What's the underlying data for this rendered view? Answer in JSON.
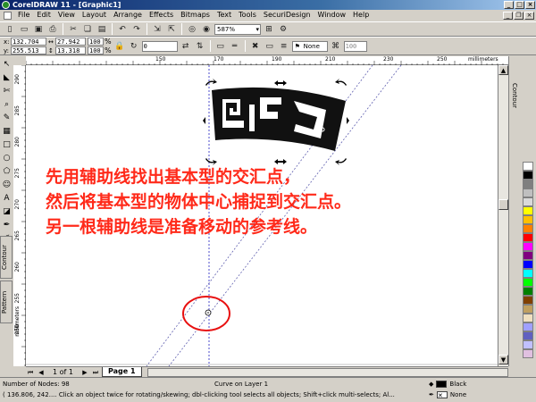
{
  "window": {
    "title": "CorelDRAW 11 - [Graphic1]"
  },
  "menu": [
    "File",
    "Edit",
    "View",
    "Layout",
    "Arrange",
    "Effects",
    "Bitmaps",
    "Text",
    "Tools",
    "SecuriDesign",
    "Window",
    "Help"
  ],
  "toolbar": {
    "zoom": "587%"
  },
  "property_bar": {
    "x": "132.704",
    "y": "255.513",
    "width": "27.942",
    "height": "13.318",
    "scale_w": "100",
    "scale_h": "100",
    "percent_sign": "%",
    "rotation": "0",
    "outline": "None",
    "opacity": "100"
  },
  "rulers": {
    "units": "millimeters",
    "h_ticks": [
      "150",
      "160",
      "170",
      "180",
      "190",
      "200",
      "210",
      "220",
      "230",
      "240",
      "250",
      "260"
    ],
    "v_ticks": [
      "240",
      "245",
      "250",
      "255",
      "260",
      "265",
      "270",
      "275",
      "280",
      "285",
      "290"
    ]
  },
  "dockers": {
    "left_tab_1": "Contour",
    "left_tab_2": "Pattern",
    "right_tab": "Contour"
  },
  "caption": {
    "line1": "先用辅助线找出基本型的交汇点，",
    "line2": "然后将基本型的物体中心捕捉到交汇点。",
    "line3": "另一根辅助线是准备移动的参考线。"
  },
  "page_nav": {
    "count": "1 of 1",
    "page_tab": "Page 1"
  },
  "palette": {
    "colors": [
      "#ffffff",
      "#000000",
      "#7f7f7f",
      "#bfbfbf",
      "#d9d9d9",
      "#ffff00",
      "#ffc000",
      "#ff8000",
      "#ff0000",
      "#ff00ff",
      "#800080",
      "#0000ff",
      "#00ffff",
      "#00ff00",
      "#008000",
      "#804000",
      "#c0a060",
      "#f0e0c0",
      "#a0a0ff",
      "#6060c0",
      "#c0c0ff",
      "#e0c0e0"
    ]
  },
  "status": {
    "nodes": "Number of Nodes: 98",
    "layer": "Curve on Layer 1",
    "hint": "( 136.806, 242.... Click an object twice for rotating/skewing; dbl-clicking tool selects all objects; Shift+click multi-selects; Al...",
    "fill": "Black",
    "outline": "None",
    "fill_color": "#000000"
  }
}
